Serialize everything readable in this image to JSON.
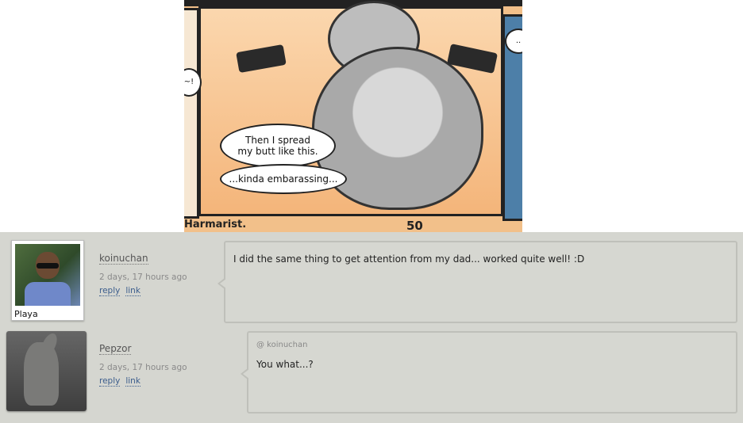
{
  "comic": {
    "bubble_1": "Then I spread\nmy butt like this.",
    "bubble_2": "...kinda embarassing...",
    "side_left": "~!",
    "side_right": "..",
    "credit": "Harmarist.",
    "page_number": "50"
  },
  "comments": [
    {
      "username": "koinuchan",
      "avatar_caption": "Playa",
      "time": "2 days, 17 hours ago",
      "reply_label": "reply",
      "link_label": "link",
      "text": "I did the same thing to get attention from my dad... worked quite well! :D"
    },
    {
      "username": "Pepzor",
      "time": "2 days, 17 hours ago",
      "reply_label": "reply",
      "link_label": "link",
      "reply_to": "@ koinuchan",
      "text": "You what...?"
    }
  ]
}
